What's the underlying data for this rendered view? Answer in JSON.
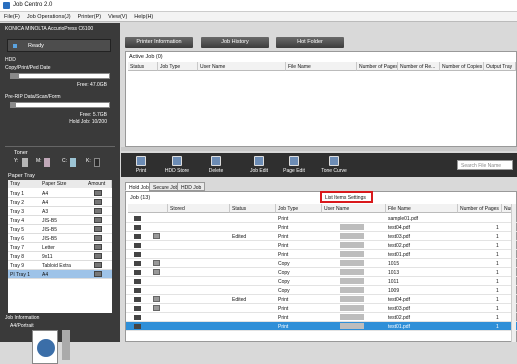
{
  "window": {
    "title": "Job Centro 2.0"
  },
  "menu": [
    "File(F)",
    "Job Operations(J)",
    "Printer(P)",
    "View(V)",
    "Help(H)"
  ],
  "left": {
    "model": "KONICA MINOLTA AccurioPress C6100",
    "status": "Ready",
    "hdd_label": "HDD",
    "copy_label": "Copy/Print/Ped Date",
    "copy_free": "Free: 47.0GB",
    "prerip_label": "Pre-RIP Data/Scan/Form",
    "prerip_free": "Free: 5.7GB",
    "hold_jobs": "Hold Job: 10/200",
    "toner_label": "Toner",
    "toner": [
      {
        "name": "Y:",
        "color": "#b5b5b5"
      },
      {
        "name": "M:",
        "color": "#c0a8b8"
      },
      {
        "name": "C:",
        "color": "#9cc4d4"
      },
      {
        "name": "K:",
        "color": "#2a2a2a"
      }
    ],
    "paper_tray_label": "Paper Tray",
    "tray_headers": [
      "Tray",
      "Paper Size",
      "Amount"
    ],
    "trays": [
      {
        "tray": "Tray 1",
        "size": "A4"
      },
      {
        "tray": "Tray 2",
        "size": "A4"
      },
      {
        "tray": "Tray 3",
        "size": "A3"
      },
      {
        "tray": "Tray 4",
        "size": "JIS-B5"
      },
      {
        "tray": "Tray 5",
        "size": "JIS-B5"
      },
      {
        "tray": "Tray 6",
        "size": "JIS-B5"
      },
      {
        "tray": "Tray 7",
        "size": "Letter"
      },
      {
        "tray": "Tray 8",
        "size": "9x11"
      },
      {
        "tray": "Tray 9",
        "size": "Tabloid Extra"
      },
      {
        "tray": "PI Tray 1",
        "size": "A4"
      }
    ],
    "job_info_label": "Job Information",
    "job_info_value": "A4/Portrait"
  },
  "top_buttons": [
    "Printer Information",
    "Job History",
    "Hot Folder"
  ],
  "active_job": {
    "label": "Active Job (0)",
    "headers": [
      "Status",
      "Job Type",
      "User Name",
      "File Name",
      "Number of Pages",
      "Number of Re...",
      "Number of Copies",
      "Output Tray"
    ]
  },
  "toolbar": [
    "Print",
    "HDD Store",
    "Delete",
    "Job Edit",
    "Page Edit",
    "Tone Curve"
  ],
  "search_placeholder": "Search File Name",
  "tabs": [
    "Hold Job",
    "Secure Job",
    "HDD Job"
  ],
  "job_count": "Job (13)",
  "job_headers": [
    "Stored",
    "Status",
    "Job Type",
    "User Name",
    "File Name",
    "Number of Pages",
    "Num"
  ],
  "jobs": [
    {
      "stored": "",
      "status": "",
      "type": "Print",
      "file": "sample01.pdf",
      "pages": ""
    },
    {
      "stored": "",
      "status": "",
      "type": "Print",
      "file": "test04.pdf",
      "pages": "1"
    },
    {
      "stored": "y",
      "status": "Edited",
      "type": "Print",
      "file": "test03.pdf",
      "pages": "1"
    },
    {
      "stored": "",
      "status": "",
      "type": "Print",
      "file": "test02.pdf",
      "pages": "1"
    },
    {
      "stored": "",
      "status": "",
      "type": "Print",
      "file": "test01.pdf",
      "pages": "1"
    },
    {
      "stored": "y",
      "status": "",
      "type": "Copy",
      "file": "1015",
      "pages": "1"
    },
    {
      "stored": "y",
      "status": "",
      "type": "Copy",
      "file": "1013",
      "pages": "1"
    },
    {
      "stored": "",
      "status": "",
      "type": "Copy",
      "file": "1011",
      "pages": "1"
    },
    {
      "stored": "",
      "status": "",
      "type": "Copy",
      "file": "1009",
      "pages": "1"
    },
    {
      "stored": "y",
      "status": "Edited",
      "type": "Print",
      "file": "test04.pdf",
      "pages": "1"
    },
    {
      "stored": "y",
      "status": "",
      "type": "Print",
      "file": "test03.pdf",
      "pages": "1"
    },
    {
      "stored": "",
      "status": "",
      "type": "Print",
      "file": "test02.pdf",
      "pages": "1"
    },
    {
      "stored": "",
      "status": "",
      "type": "Print",
      "file": "test01.pdf",
      "pages": "1"
    }
  ],
  "context_menu": "List Items Settings",
  "accent": "#2f8fd8",
  "highlight": "#d9191c"
}
